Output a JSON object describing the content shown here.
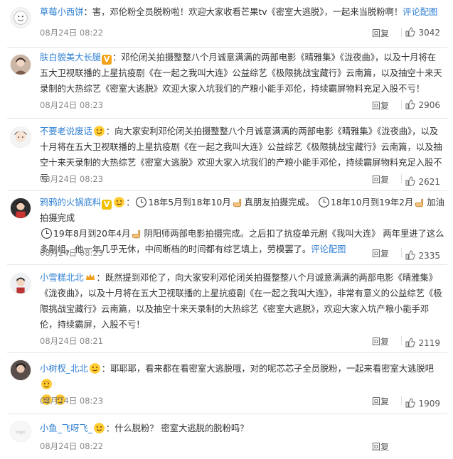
{
  "ui": {
    "reply_label": "回复",
    "comment_reply_label": "评论配图",
    "inline_link_label": "评论配图"
  },
  "comments": [
    {
      "username": "草莓小西饼",
      "text": "：害，邓伦粉全员脱粉啦！欢迎大家收看芒果tv《密室大逃脱》，一起来当脱粉啊！",
      "date": "08月24日 08:22",
      "likes": "3042",
      "link": "评论配图"
    },
    {
      "username": "肤白貌美大长腿",
      "text": "：邓伦闭关拍摄整整八个月诚意满满的两部电影《晴雅集》《泷夜曲》，以及十月将在五大卫视联播的上星抗疫剧《在一起之我叫大连》公益综艺《极限挑战宝藏行》云南篇，以及抽空十来天录制的大热综艺《密室大逃脱》欢迎大家入坑我们的产粮小能手邓伦，持续霸屏物料充足入股不亏！",
      "date": "08月24日 08:23",
      "likes": "2906"
    },
    {
      "username": "不要老说废话",
      "text": "：向大家安利邓伦闭关拍摄整整八个月诚意满满的两部电影《晴雅集》《泷夜曲》，以及十月将在五大卫视联播的上星抗疫剧《在一起之我叫大连》公益综艺《极限挑战宝藏行》云南篇，以及抽空十来天录制的大热综艺《密室大逃脱》欢迎大家入坑我们的产粮小能手邓伦，持续霸屏物料充足入股不亏",
      "date": "08月24日 08:23",
      "likes": "2621"
    },
    {
      "username": "鸦鸦的火锅底料",
      "text_a": "18年5月到18年10月",
      "text_b": "真朋友拍摄完成。",
      "text_c": "18年10月到19年2月",
      "text_d": "加油拍摄完成",
      "text_e": "19年8月到20年4月",
      "text_f": "阴阳师两部电影拍摄完成。之后扣了抗疫单元剧《我叫大连》 两年里进了这么多剧组，他一年几乎无休，中间断档的时间都有综艺填上，劳模罢了。",
      "link": "评论配图",
      "date": "08月24日 08:23",
      "likes": "2335"
    },
    {
      "username": "小雪糕北北",
      "text": "：既然提到邓伦了，向大家安利邓伦闭关拍摄整整八个月诚意满满的两部电影《晴雅集》《泷夜曲》，以及十月将在五大卫视联播的上星抗疫剧《在一起之我叫大连》，非常有意义的公益综艺《极限挑战宝藏行》云南篇，以及抽空十来天录制的大热综艺《密室大逃脱》，欢迎大家入坑产粮小能手邓伦，持续霸屏，入股不亏！",
      "date": "08月24日 08:21",
      "likes": "2119"
    },
    {
      "username": "小树杈_北北",
      "text": "：耶耶耶，看来都在看密室大逃脱哦，对的呢芯芯子全员脱粉，一起来看密室大逃脱吧",
      "date": "08月24日 08:23",
      "likes": "1909"
    },
    {
      "username": "小鱼_飞呀飞_",
      "text": "：什么脱粉？ 密室大逃脱的脱粉吗？",
      "date": "08月24日 08:22",
      "likes": ""
    }
  ],
  "colors": {
    "username_orange": "#eb7350",
    "link_blue": "#2f7fd3",
    "meta_gray": "#888888"
  },
  "icons": [
    "vip-badge",
    "crown-icon",
    "thumb-up-icon",
    "hand-point-icon",
    "clock-icon",
    "emoji-icon"
  ]
}
